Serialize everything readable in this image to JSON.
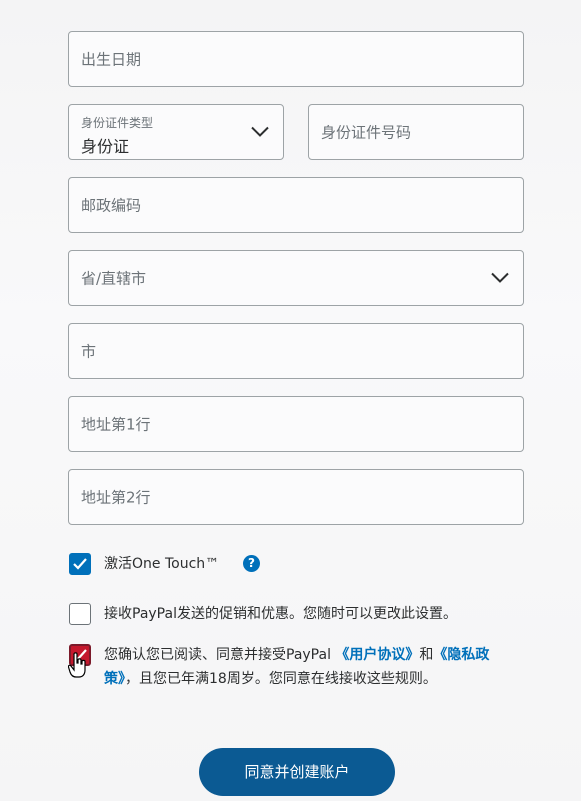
{
  "form": {
    "birthdate_placeholder": "出生日期",
    "id_type_label": "身份证件类型",
    "id_type_value": "身份证",
    "id_number_placeholder": "身份证件号码",
    "postal_code_placeholder": "邮政编码",
    "province_placeholder": "省/直辖市",
    "city_placeholder": "市",
    "address_line1_placeholder": "地址第1行",
    "address_line2_placeholder": "地址第2行"
  },
  "options": {
    "one_touch_label": "激活One Touch™",
    "one_touch_checked": true,
    "promo_label": "接收PayPal发送的促销和优惠。您随时可以更改此设置。",
    "promo_checked": false,
    "agreement_checked": true,
    "agreement_text_1": "您确认您已阅读、同意并接受PayPal ",
    "agreement_link_user": "《用户协议》",
    "agreement_and": "和",
    "agreement_link_privacy": "《隐私政策》",
    "agreement_text_2": "，且您已年满18周岁。您同意在线接收这些规则。"
  },
  "submit_label": "同意并创建账户",
  "colors": {
    "accent": "#0070ba",
    "button": "#0b5a93",
    "border": "#9da3a6"
  }
}
